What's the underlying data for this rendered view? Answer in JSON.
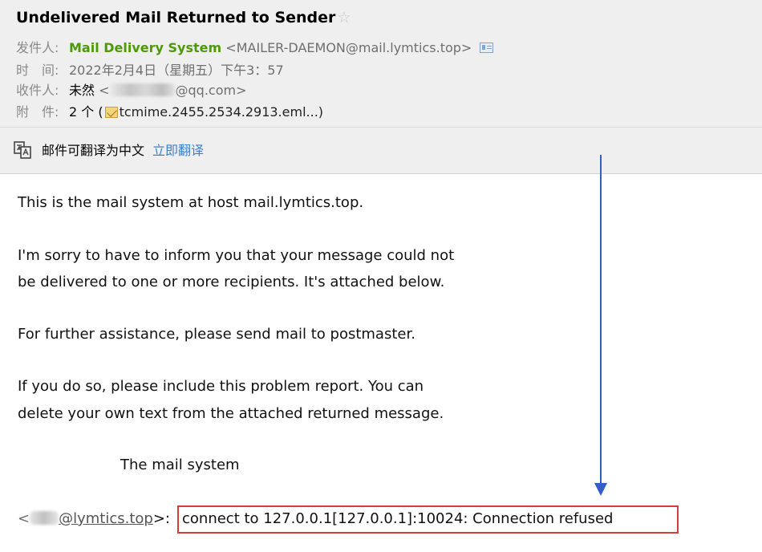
{
  "email": {
    "subject": "Undelivered Mail Returned to Sender",
    "star_icon": "☆",
    "from": {
      "label": "发件人:",
      "name": "Mail Delivery System",
      "address": "<MAILER-DAEMON@mail.lymtics.top>"
    },
    "time": {
      "label": "时　间:",
      "value": "2022年2月4日（星期五）下午3：57"
    },
    "to": {
      "label": "收件人:",
      "name": "未然",
      "address_prefix": "<",
      "address_suffix": "@qq.com>"
    },
    "attachments": {
      "label": "附　件:",
      "count": "2 个 (",
      "filename": "tcmime.2455.2534.2913.eml...)"
    }
  },
  "translate_bar": {
    "text": "邮件可翻译为中文",
    "link": "立即翻译"
  },
  "body": {
    "line1": "This is the mail system at host mail.lymtics.top.",
    "line2": "I'm sorry to have to inform you that your message could not",
    "line3": "be delivered to one or more recipients. It's attached below.",
    "line4": "For further assistance, please send mail to postmaster.",
    "line5": "If you do so, please include this problem report. You can",
    "line6": "delete your own text from the attached returned message.",
    "signature": "The mail system",
    "recipient_prefix": "<",
    "recipient_domain": "@lymtics.top",
    "recipient_suffix": ">:",
    "error_message": "connect to 127.0.0.1[127.0.0.1]:10024: Connection refused"
  },
  "annotation": {
    "arrow_color": "#2f5fc7",
    "box_color": "#d93a3a"
  },
  "colors": {
    "sender_name": "#4e9a06",
    "link": "#3c7fcf",
    "header_bg": "#efefef"
  }
}
